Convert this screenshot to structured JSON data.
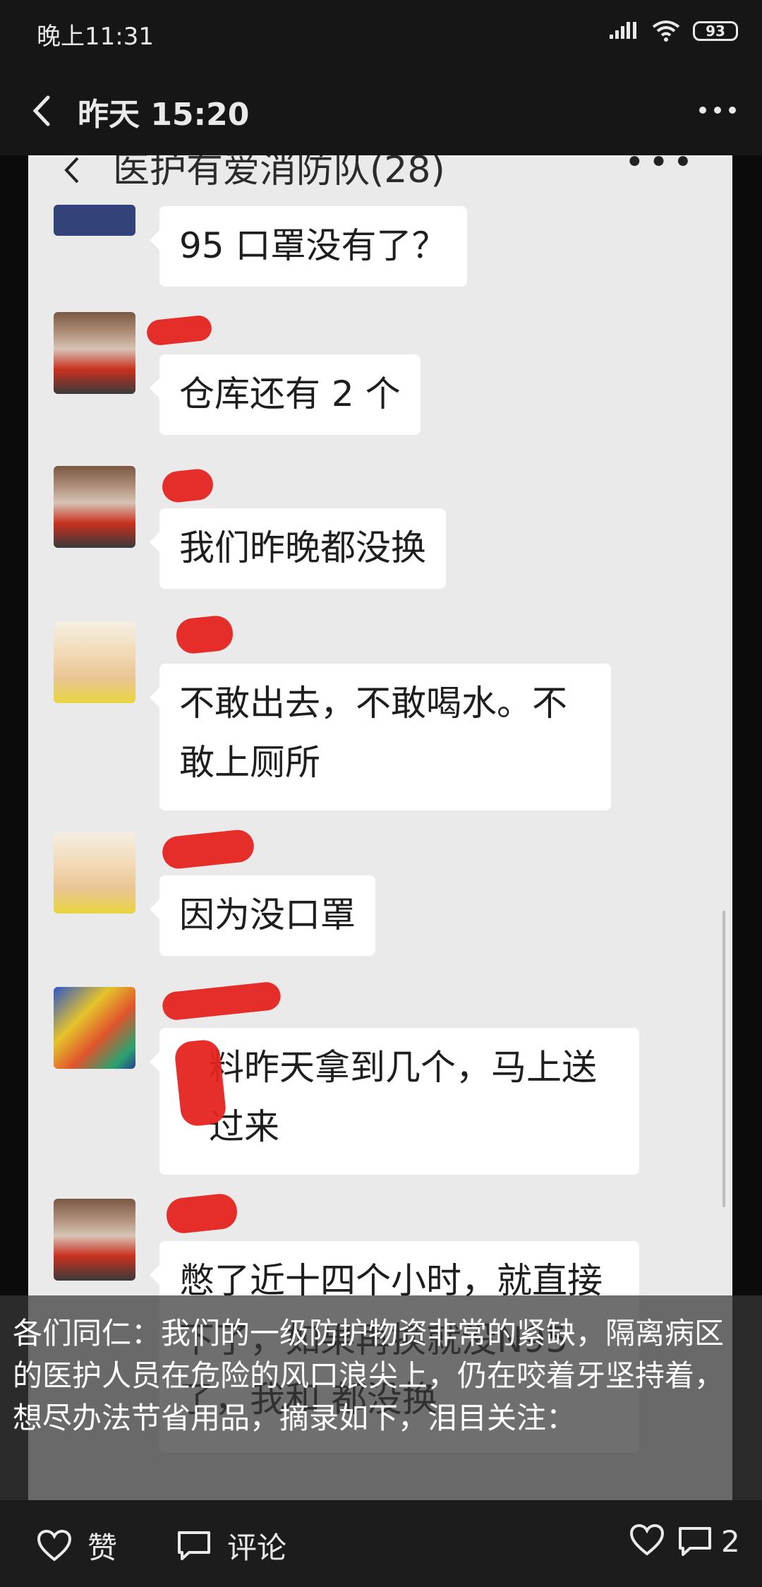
{
  "status_bar": {
    "time": "晚上11:31",
    "battery": "93"
  },
  "header": {
    "title": "昨天 15:20"
  },
  "chat": {
    "title": "医护有爱消防队(28)",
    "more": "•••",
    "messages": [
      {
        "text": "95 口罩没有了？"
      },
      {
        "text": "仓库还有 2 个"
      },
      {
        "text": "我们昨晚都没换"
      },
      {
        "text": "不敢出去，不敢喝水。不敢上厕所"
      },
      {
        "text": "因为没口罩"
      },
      {
        "text": "料昨天拿到几个，马上送过来"
      },
      {
        "text": "憋了近十四个小时，就直接下了，如果再换就没N95了，我和   都没换"
      }
    ]
  },
  "caption": {
    "text": "各们同仁：我们的一级防护物资非常的紧缺，隔离病区的医护人员在危险的风口浪尖上，仍在咬着牙坚持着，想尽办法节省用品，摘录如下，泪目关注："
  },
  "bottom_bar": {
    "like_label": "赞",
    "comment_label": "评论",
    "comment_count": "2"
  }
}
